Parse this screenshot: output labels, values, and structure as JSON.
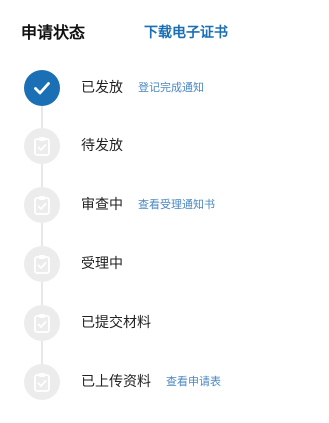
{
  "header": {
    "title": "申请状态",
    "download_link": "下载电子证书"
  },
  "colors": {
    "accent": "#1a6fb5",
    "link": "#4a88c2",
    "inactive_circle": "#ececec",
    "track": "#e8e8e8"
  },
  "steps": [
    {
      "label": "已发放",
      "status": "done",
      "icon": "check-icon",
      "link": "登记完成通知"
    },
    {
      "label": "待发放",
      "status": "pending",
      "icon": "clipboard-check-icon",
      "link": ""
    },
    {
      "label": "审查中",
      "status": "pending",
      "icon": "clipboard-check-icon",
      "link": "查看受理通知书"
    },
    {
      "label": "受理中",
      "status": "pending",
      "icon": "clipboard-check-icon",
      "link": ""
    },
    {
      "label": "已提交材料",
      "status": "pending",
      "icon": "clipboard-check-icon",
      "link": ""
    },
    {
      "label": "已上传资料",
      "status": "pending",
      "icon": "clipboard-check-icon",
      "link": "查看申请表"
    }
  ]
}
